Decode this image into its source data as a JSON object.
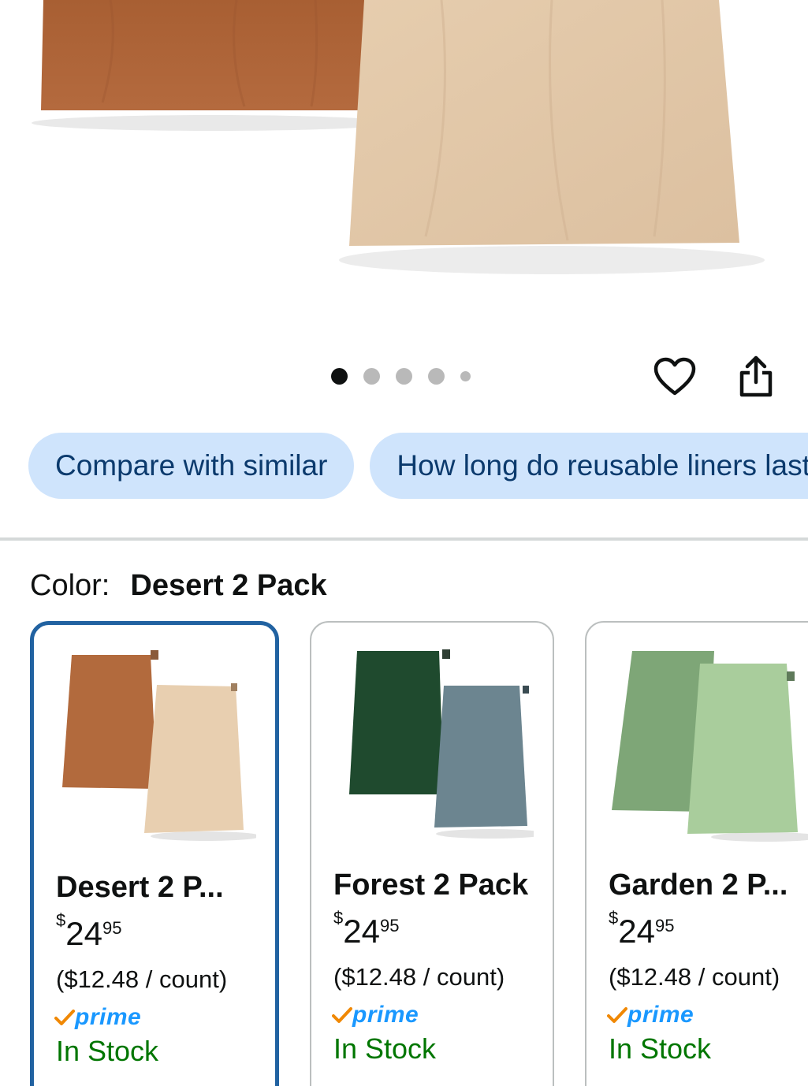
{
  "gallery": {
    "dots": [
      {
        "active": true,
        "size": "large"
      },
      {
        "active": false,
        "size": "large"
      },
      {
        "active": false,
        "size": "large"
      },
      {
        "active": false,
        "size": "large"
      },
      {
        "active": false,
        "size": "small"
      }
    ],
    "favorite_icon": "heart-outline-icon",
    "share_icon": "share-icon"
  },
  "chips": [
    "Compare with similar",
    "How long do reusable liners last?"
  ],
  "color": {
    "label": "Color:",
    "value": "Desert 2 Pack"
  },
  "swatches": [
    {
      "name": "Desert 2 P...",
      "currency": "$",
      "price_whole": "24",
      "price_cents": "95",
      "unit": "($12.48 / count)",
      "prime": "prime",
      "stock": "In Stock",
      "selected": true,
      "colors": [
        "#b26a3d",
        "#e8cfb0"
      ]
    },
    {
      "name": "Forest 2 Pack",
      "currency": "$",
      "price_whole": "24",
      "price_cents": "95",
      "unit": "($12.48 / count)",
      "prime": "prime",
      "stock": "In Stock",
      "selected": false,
      "colors": [
        "#1f4a2e",
        "#6c8590"
      ]
    },
    {
      "name": "Garden 2 P...",
      "currency": "$",
      "price_whole": "24",
      "price_cents": "95",
      "unit": "($12.48 / count)",
      "prime": "prime",
      "stock": "In Stock",
      "selected": false,
      "colors": [
        "#7ea677",
        "#a9cd9c"
      ]
    }
  ],
  "theme": {
    "chip_bg": "#cfe4fc",
    "chip_text": "#0b3a6d",
    "selected_border": "#2162a1",
    "stock_green": "#007600",
    "prime_blue": "#1a98ff",
    "prime_check": "#f08804"
  }
}
